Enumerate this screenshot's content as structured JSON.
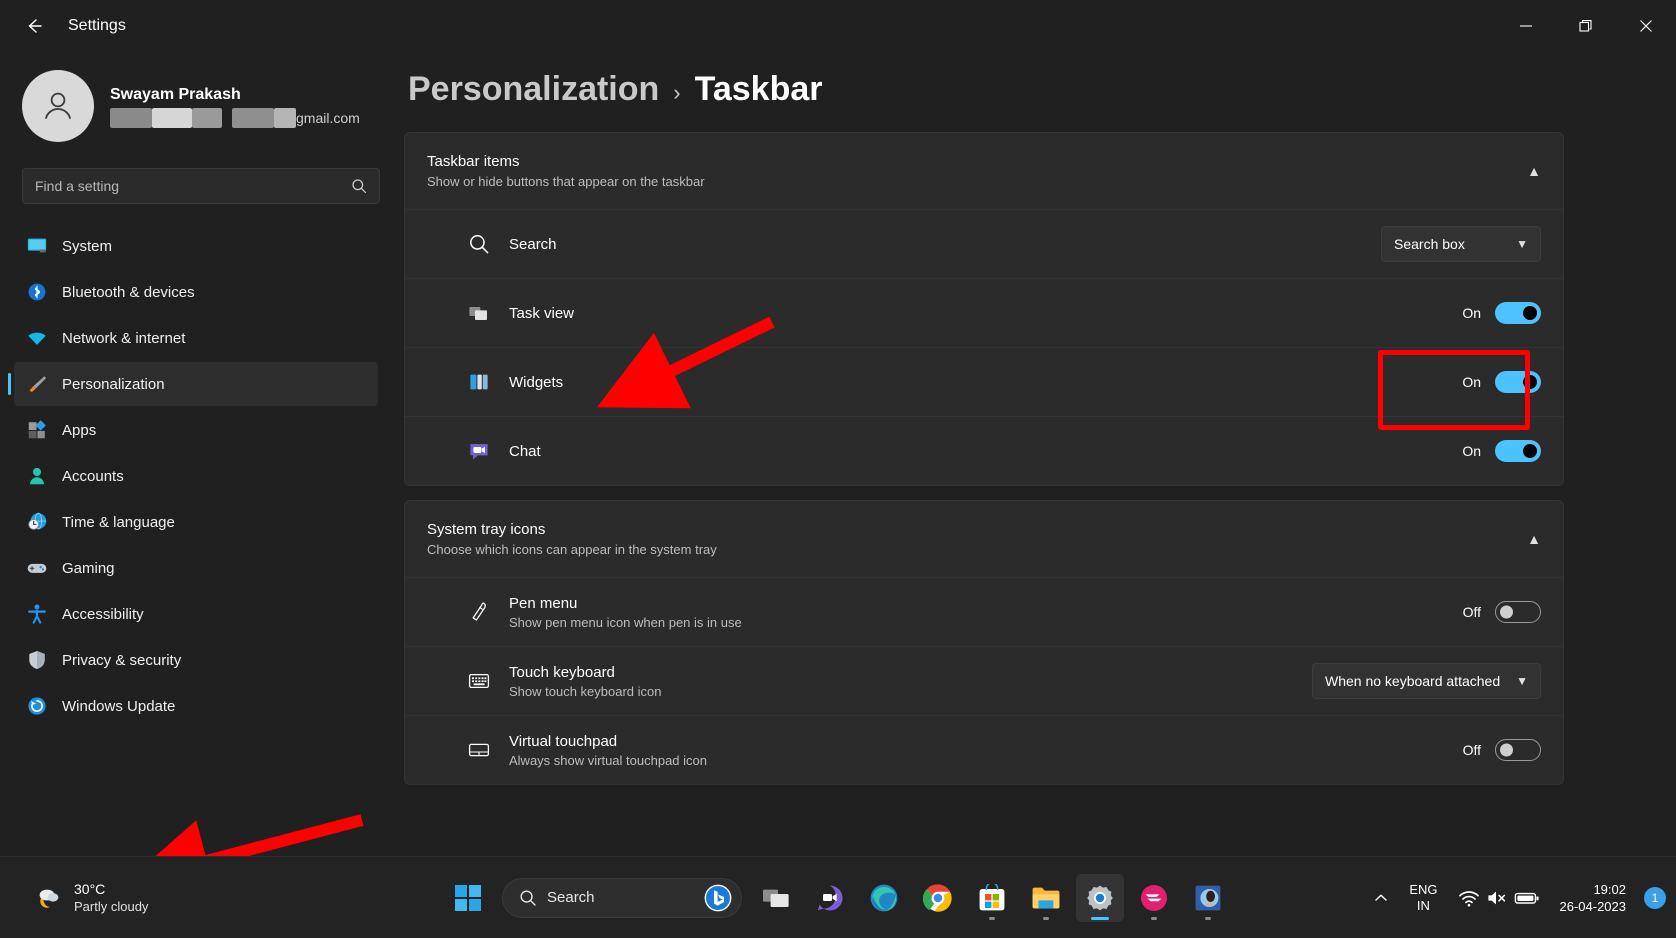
{
  "window": {
    "title": "Settings",
    "back_label": "back-arrow",
    "minimize_label": "Minimize",
    "restore_label": "Restore",
    "close_label": "Close"
  },
  "profile": {
    "name": "Swayam Prakash",
    "email_suffix": "gmail.com"
  },
  "search": {
    "placeholder": "Find a setting",
    "value": ""
  },
  "sidebar": {
    "items": [
      {
        "label": "System",
        "icon": "monitor-icon",
        "active": false
      },
      {
        "label": "Bluetooth & devices",
        "icon": "bluetooth-icon",
        "active": false
      },
      {
        "label": "Network & internet",
        "icon": "wifi-icon",
        "active": false
      },
      {
        "label": "Personalization",
        "icon": "brush-icon",
        "active": true
      },
      {
        "label": "Apps",
        "icon": "apps-icon",
        "active": false
      },
      {
        "label": "Accounts",
        "icon": "person-icon",
        "active": false
      },
      {
        "label": "Time & language",
        "icon": "clock-globe-icon",
        "active": false
      },
      {
        "label": "Gaming",
        "icon": "gamepad-icon",
        "active": false
      },
      {
        "label": "Accessibility",
        "icon": "accessibility-icon",
        "active": false
      },
      {
        "label": "Privacy & security",
        "icon": "shield-icon",
        "active": false
      },
      {
        "label": "Windows Update",
        "icon": "update-icon",
        "active": false
      }
    ]
  },
  "breadcrumb": {
    "parent": "Personalization",
    "separator": "›",
    "current": "Taskbar"
  },
  "sections": [
    {
      "title": "Taskbar items",
      "subtitle": "Show or hide buttons that appear on the taskbar",
      "collapse_icon": "chevron-up-icon",
      "rows": [
        {
          "title": "Search",
          "subtitle": "",
          "icon": "search-icon",
          "control": "dropdown",
          "value": "Search box",
          "chevron": "chevron-down-icon"
        },
        {
          "title": "Task view",
          "subtitle": "",
          "icon": "taskview-icon",
          "control": "toggle",
          "state": "On"
        },
        {
          "title": "Widgets",
          "subtitle": "",
          "icon": "widgets-icon",
          "control": "toggle",
          "state": "On",
          "highlighted": true
        },
        {
          "title": "Chat",
          "subtitle": "",
          "icon": "chat-icon",
          "control": "toggle",
          "state": "On"
        }
      ]
    },
    {
      "title": "System tray icons",
      "subtitle": "Choose which icons can appear in the system tray",
      "collapse_icon": "chevron-up-icon",
      "rows": [
        {
          "title": "Pen menu",
          "subtitle": "Show pen menu icon when pen is in use",
          "icon": "pen-icon",
          "control": "toggle",
          "state": "Off"
        },
        {
          "title": "Touch keyboard",
          "subtitle": "Show touch keyboard icon",
          "icon": "keyboard-icon",
          "control": "dropdown",
          "value": "When no keyboard attached",
          "chevron": "chevron-down-icon"
        },
        {
          "title": "Virtual touchpad",
          "subtitle": "Always show virtual touchpad icon",
          "icon": "touchpad-icon",
          "control": "toggle",
          "state": "Off"
        }
      ]
    }
  ],
  "annotations": {
    "highlight_color": "#ff0000",
    "arrow_to_widgets": "red-arrow-pointing-to-widgets",
    "arrow_to_weather": "red-arrow-pointing-to-weather-widget",
    "box_around_widgets_toggle": "red-rectangle-around-widgets-toggle"
  },
  "taskbar": {
    "weather": {
      "temperature": "30°C",
      "condition": "Partly cloudy",
      "icon": "cloud-moon-icon"
    },
    "start": {
      "label": "Start",
      "icon": "windows-logo-icon"
    },
    "search": {
      "label": "Search",
      "icon": "search-icon",
      "bing_icon": "bing-chat-icon"
    },
    "apps": [
      {
        "name": "task-view-icon",
        "label": "Task view",
        "running": false,
        "active": false
      },
      {
        "name": "chat-icon",
        "label": "Chat",
        "running": false,
        "active": false
      },
      {
        "name": "edge-icon",
        "label": "Microsoft Edge",
        "running": false,
        "active": false
      },
      {
        "name": "chrome-icon",
        "label": "Google Chrome",
        "running": true,
        "active": false
      },
      {
        "name": "microsoft-store-icon",
        "label": "Microsoft Store",
        "running": true,
        "active": false
      },
      {
        "name": "file-explorer-icon",
        "label": "File Explorer",
        "running": true,
        "active": false
      },
      {
        "name": "settings-icon",
        "label": "Settings",
        "running": true,
        "active": true
      },
      {
        "name": "app-pink-icon",
        "label": "App",
        "running": true,
        "active": false
      },
      {
        "name": "app-photo-icon",
        "label": "App",
        "running": true,
        "active": false
      }
    ],
    "tray": {
      "overflow_icon": "chevron-up-icon",
      "language_top": "ENG",
      "language_bottom": "IN",
      "wifi_icon": "wifi-icon",
      "volume_icon": "speaker-muted-icon",
      "battery_icon": "battery-icon",
      "time": "19:02",
      "date": "26-04-2023",
      "notification_count": "1"
    }
  }
}
